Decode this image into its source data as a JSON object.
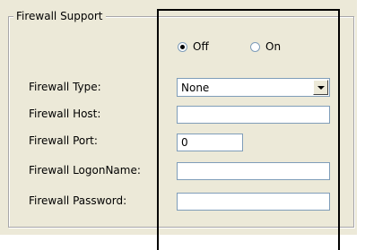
{
  "group": {
    "title": "Firewall Support"
  },
  "radios": [
    {
      "label": "Off",
      "checked": true
    },
    {
      "label": "On",
      "checked": false
    }
  ],
  "fields": {
    "type_label": "Firewall Type:",
    "type_value": "None",
    "host_label": "Firewall Host:",
    "host_value": "",
    "port_label": "Firewall Port:",
    "port_value": "0",
    "logon_label": "Firewall LogonName:",
    "logon_value": "",
    "password_label": "Firewall Password:",
    "password_value": ""
  },
  "icons": {
    "dropdown": "chevron-down-icon"
  }
}
